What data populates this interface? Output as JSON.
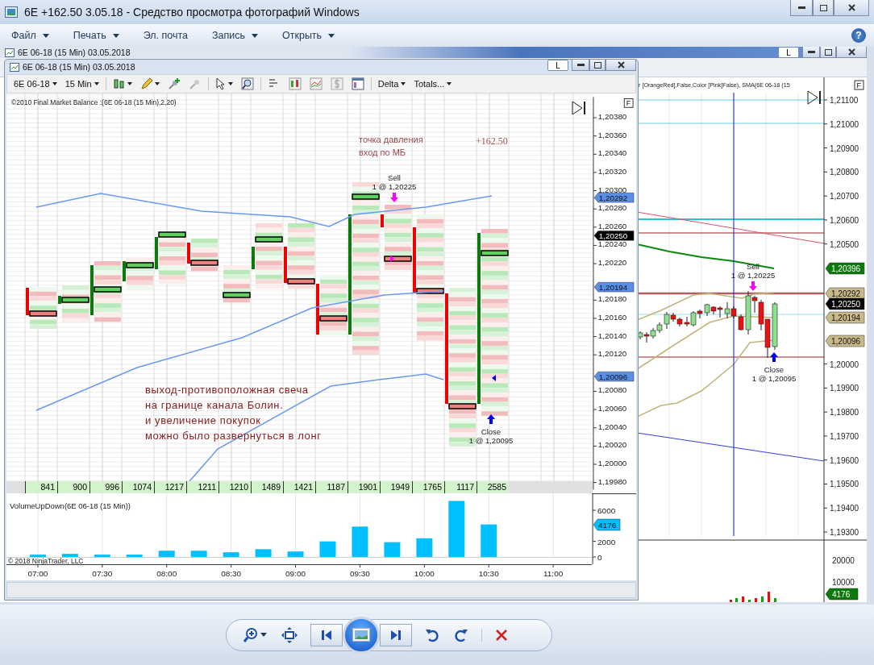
{
  "viewer": {
    "title": "6E  +162.50  3.05.18 - Средство просмотра фотографий Windows",
    "menu": [
      {
        "label": "Файл",
        "dropdown": true
      },
      {
        "label": "Печать",
        "dropdown": true
      },
      {
        "label": "Эл. почта",
        "dropdown": false
      },
      {
        "label": "Запись",
        "dropdown": true
      },
      {
        "label": "Открыть",
        "dropdown": true
      }
    ],
    "help_label": "?"
  },
  "back_window": {
    "title": "6E 06-18 (15 Min)  03.05.2018",
    "lock_label": "L",
    "indicator_text": "r [OrangeRed],False,Color [Pink]False), SMA(6E 06-18 (15",
    "f_label": "F",
    "price_axis": [
      "1,21100",
      "1,21000",
      "1,20900",
      "1,20800",
      "1,20700",
      "1,20600",
      "1,20500",
      "1,20000",
      "1,19900",
      "1,19800",
      "1,19700",
      "1,19600",
      "1,19500",
      "1,19400",
      "1,19300"
    ],
    "price_tags": [
      {
        "label": "1,20396",
        "color": "#0b7a0b"
      },
      {
        "label": "1,20292",
        "color": "#c8b98a"
      },
      {
        "label": "1,20250",
        "color": "#000000"
      },
      {
        "label": "1,20194",
        "color": "#c8b98a"
      },
      {
        "label": "1,20096",
        "color": "#c8b98a"
      }
    ],
    "trades": [
      {
        "kind": "sell",
        "action": "Sell",
        "fill": "1 @ 1,20225"
      },
      {
        "kind": "close",
        "action": "Close",
        "fill": "1 @ 1,20095"
      }
    ],
    "volume_axis": [
      "20000",
      "10000"
    ],
    "volume_tag": "4176"
  },
  "front_window": {
    "title": "6E 06-18 (15 Min)  03.05.2018",
    "lock_label": "L",
    "toolbar": {
      "instrument": "6E 06-18",
      "interval": "15 Min",
      "delta": "Delta",
      "totals": "Totals..."
    },
    "indicator_label": "©2010 Final Market Balance :(6E 06-18 (15 Min),2,20)",
    "f_label": "F",
    "price_axis": [
      "1,20380",
      "1,20360",
      "1,20340",
      "1,20320",
      "1,20300",
      "1,20280",
      "1,20260",
      "1,20240",
      "1,20220",
      "1,20180",
      "1,20160",
      "1,20140",
      "1,20120",
      "1,20080",
      "1,20060",
      "1,20040",
      "1,20020",
      "1,20000",
      "1,19980"
    ],
    "price_tags": [
      {
        "label": "1,20292",
        "color": "#5b8ee6"
      },
      {
        "label": "1,20250",
        "color": "#000000"
      },
      {
        "label": "1,20194",
        "color": "#5b8ee6"
      },
      {
        "label": "1,20096",
        "color": "#5b8ee6"
      }
    ],
    "notes": [
      {
        "kind": "entry",
        "lines": [
          "точка давления",
          "вход по МБ"
        ]
      },
      {
        "kind": "profit",
        "lines": [
          "+162.50"
        ]
      },
      {
        "kind": "exit",
        "lines": [
          "выход-противоположная свеча",
          "на границе канала Болин.",
          "и увеличение покупок",
          "можно было развернуться  в лонг"
        ]
      }
    ],
    "trades": [
      {
        "kind": "sell",
        "action": "Sell",
        "fill": "1 @ 1,20225"
      },
      {
        "kind": "close",
        "action": "Close",
        "fill": "1 @ 1,20095"
      }
    ],
    "totals": [
      "841",
      "900",
      "996",
      "1074",
      "1217",
      "1211",
      "1210",
      "1489",
      "1421",
      "1187",
      "1901",
      "1949",
      "1765",
      "1117",
      "2585"
    ],
    "volume_panel": {
      "title": "VolumeUpDown(6E 06-18 (15 Min))",
      "copyright": "© 2018 NinjaTrader, LLC",
      "tag": "4176",
      "chart_data": {
        "type": "bar",
        "categories": [
          "07:00",
          null,
          "07:30",
          null,
          "08:00",
          null,
          "08:30",
          null,
          "09:00",
          null,
          "09:30",
          null,
          "10:00",
          null,
          "10:30",
          null,
          "11:00"
        ],
        "series": [
          {
            "color": "#00bfff",
            "values": [
              300,
              400,
              300,
              300,
              800,
              800,
              600,
              1000,
              700,
              2000,
              3900,
              1900,
              2400,
              7200,
              4176,
              null,
              null
            ]
          }
        ],
        "yticks": [
          0,
          2000,
          6000
        ],
        "ylim": [
          0,
          8170
        ],
        "grid": true
      }
    }
  }
}
